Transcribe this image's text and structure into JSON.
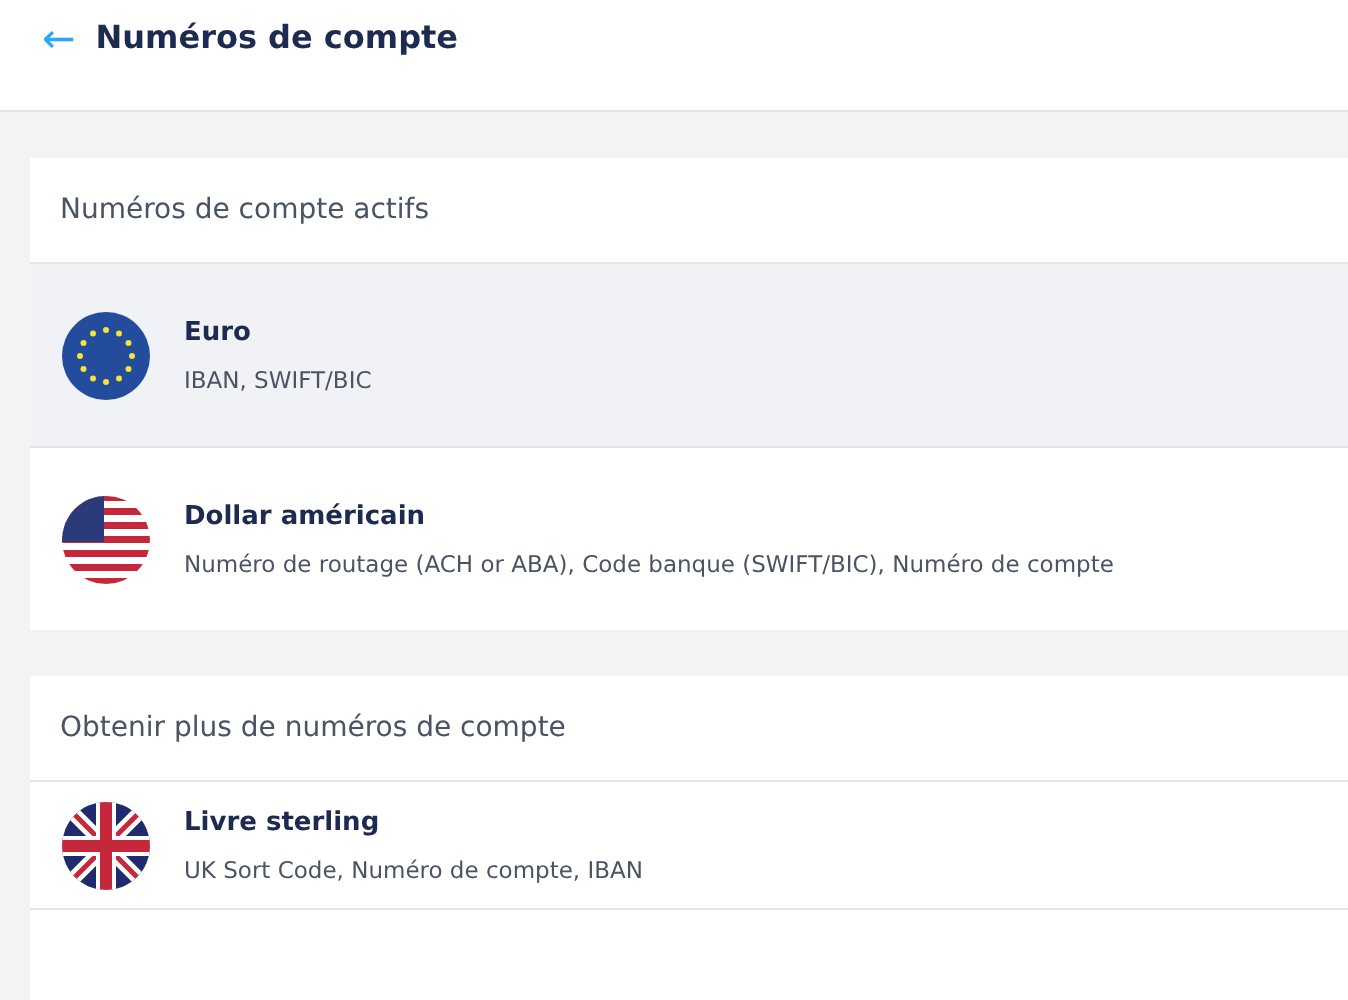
{
  "header": {
    "back_icon": "←",
    "title": "Numéros de compte"
  },
  "sections": [
    {
      "title": "Numéros de compte actifs",
      "items": [
        {
          "kind": "eu",
          "name": "Euro",
          "details": "IBAN, SWIFT/BIC",
          "selected": true
        },
        {
          "kind": "us",
          "name": "Dollar américain",
          "details": "Numéro de routage (ACH or ABA), Code banque (SWIFT/BIC), Numéro de compte",
          "selected": false
        }
      ]
    },
    {
      "title": "Obtenir plus de numéros de compte",
      "items": [
        {
          "kind": "gb",
          "name": "Livre sterling",
          "details": "UK Sort Code, Numéro de compte, IBAN",
          "selected": false
        }
      ]
    }
  ]
}
